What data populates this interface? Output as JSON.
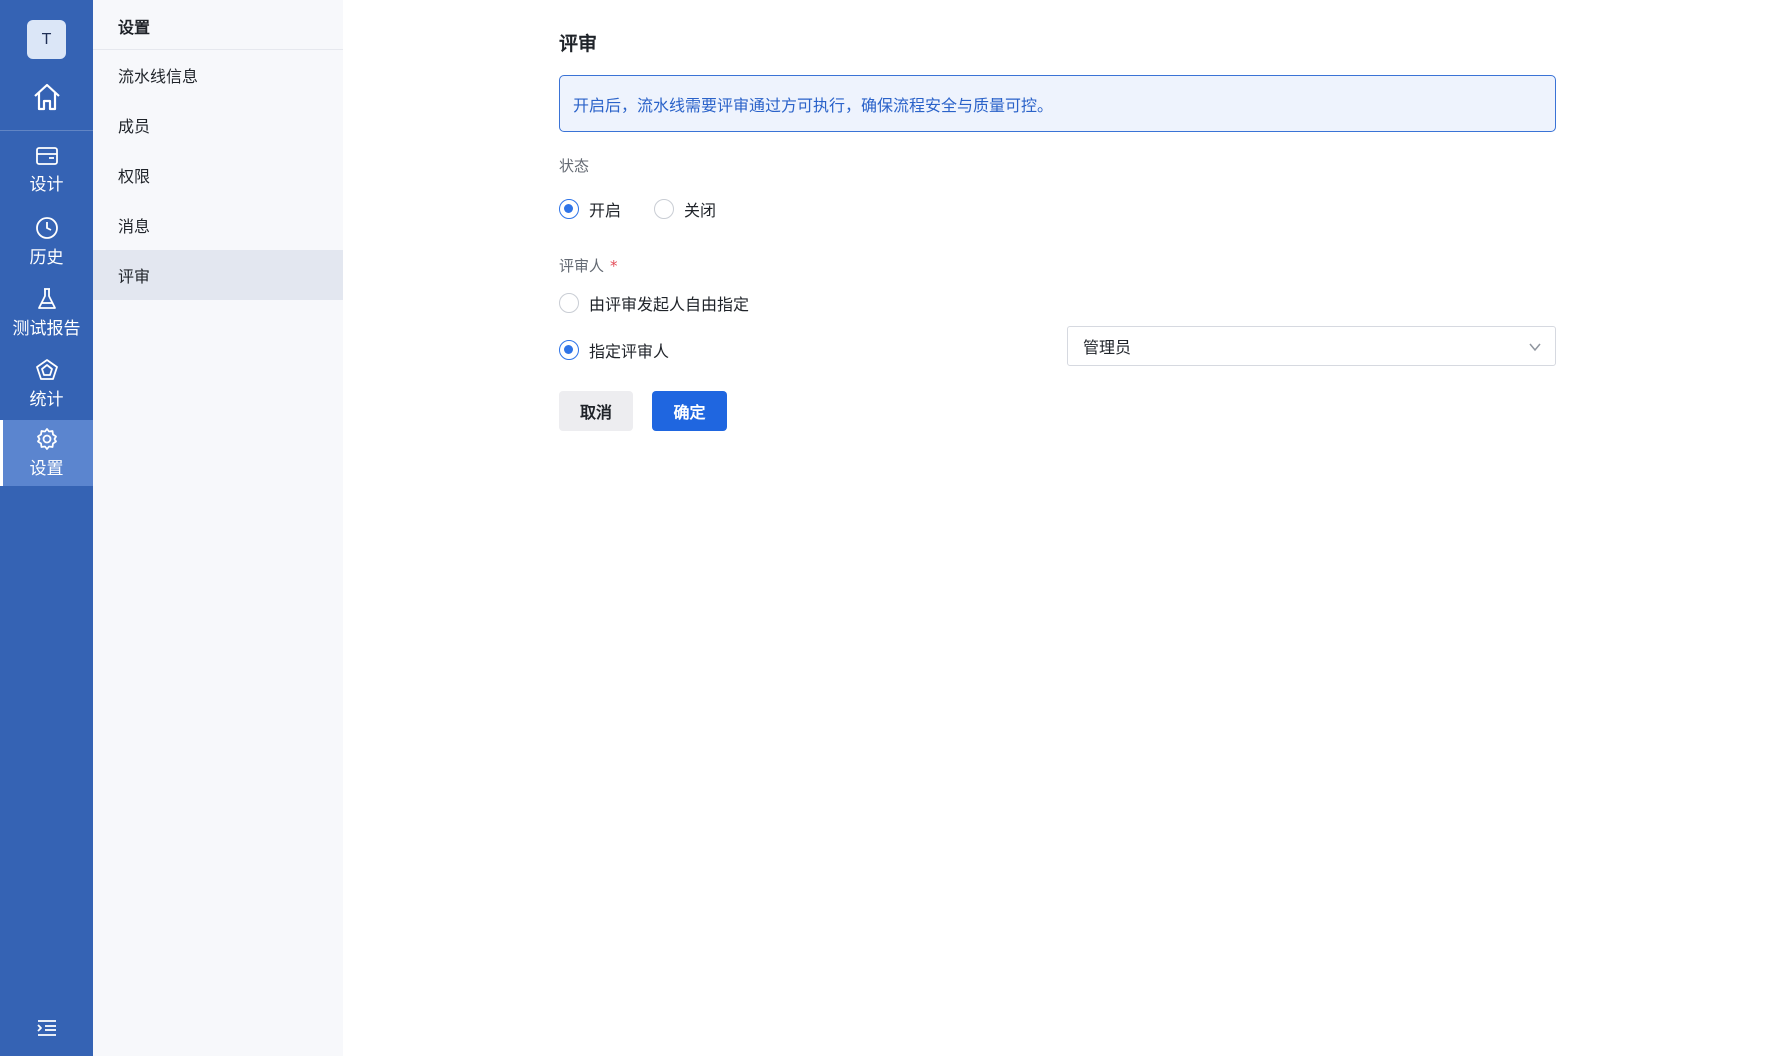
{
  "rail": {
    "avatar_letter": "T",
    "items": [
      {
        "label": "设计",
        "icon": "design-icon"
      },
      {
        "label": "历史",
        "icon": "clock-icon"
      },
      {
        "label": "测试报告",
        "icon": "flask-icon"
      },
      {
        "label": "统计",
        "icon": "stats-icon"
      },
      {
        "label": "设置",
        "icon": "gear-icon",
        "active": true
      }
    ]
  },
  "subnav": {
    "title": "设置",
    "items": [
      {
        "label": "流水线信息"
      },
      {
        "label": "成员"
      },
      {
        "label": "权限"
      },
      {
        "label": "消息"
      },
      {
        "label": "评审",
        "active": true
      }
    ]
  },
  "main": {
    "title": "评审",
    "notice": "开启后，流水线需要评审通过方可执行，确保流程安全与质量可控。",
    "status": {
      "label": "状态",
      "options": [
        {
          "label": "开启",
          "checked": true
        },
        {
          "label": "关闭",
          "checked": false
        }
      ]
    },
    "reviewer": {
      "label": "评审人",
      "required_mark": "*",
      "options": [
        {
          "label": "由评审发起人自由指定",
          "checked": false
        },
        {
          "label": "指定评审人",
          "checked": true
        }
      ],
      "select_value": "管理员"
    },
    "buttons": {
      "cancel": "取消",
      "confirm": "确定"
    }
  },
  "colors": {
    "rail_bg": "#3563b4",
    "rail_active": "#5b85cf",
    "primary": "#1f66e0",
    "notice_border": "#3a73d6"
  }
}
